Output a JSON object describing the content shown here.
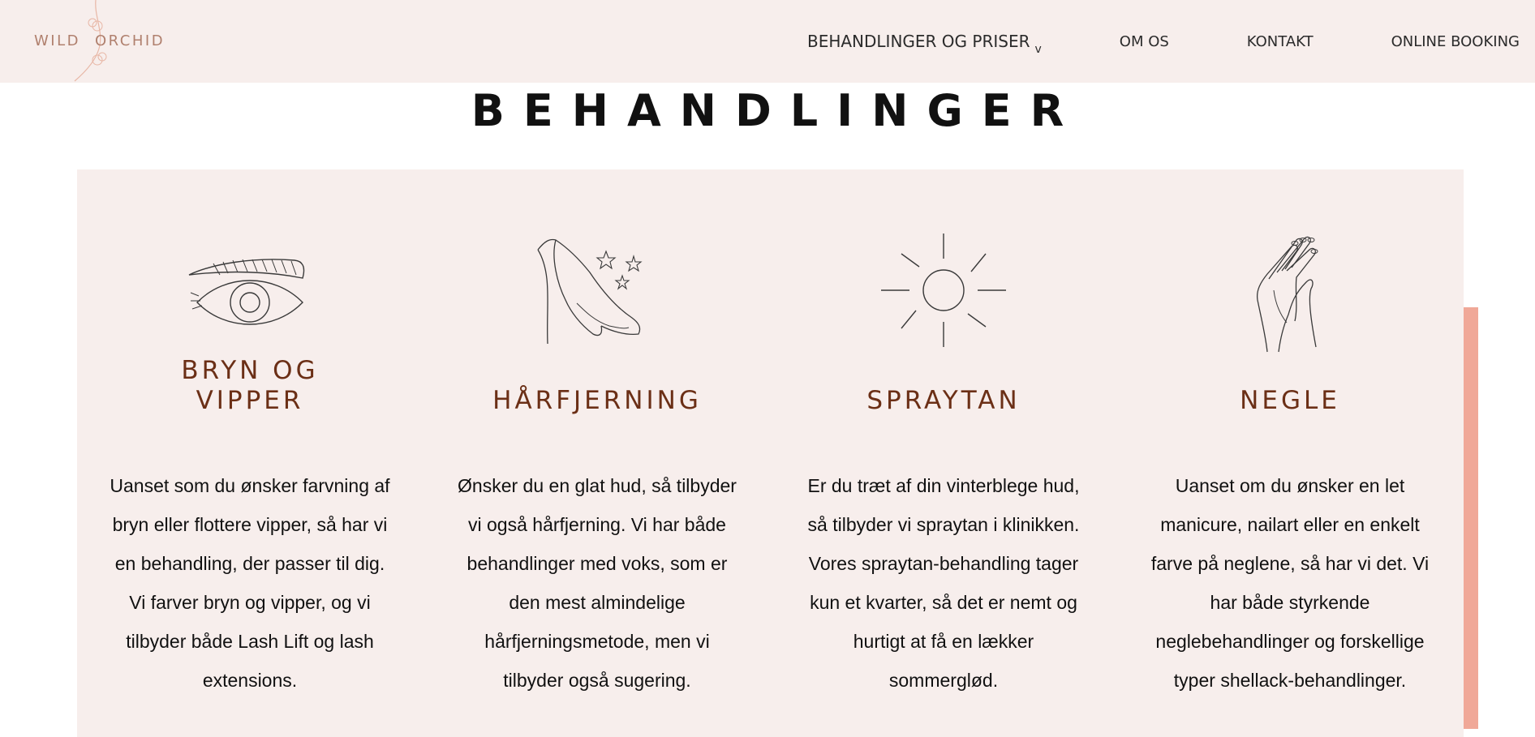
{
  "logo": {
    "word1": "WILD",
    "word2": "ORCHID"
  },
  "nav": {
    "items": [
      {
        "label": "BEHANDLINGER OG PRISER",
        "caret": "v"
      },
      {
        "label": "OM OS"
      },
      {
        "label": "KONTAKT"
      },
      {
        "label": "ONLINE BOOKING"
      }
    ]
  },
  "page_title": "BEHANDLINGER",
  "colors": {
    "header_bg": "#f7eeec",
    "panel_bg": "#f7eeec",
    "title_color": "#6b2f16",
    "accent": "#f0a898"
  },
  "treatments": [
    {
      "icon": "eye-brow-icon",
      "title_lines": [
        "BRYN OG",
        "VIPPER"
      ],
      "text": "Uanset som du ønsker farvning af bryn eller flottere vipper, så har vi en behandling, der passer til dig. Vi farver bryn og vipper, og vi tilbyder både Lash Lift og lash extensions."
    },
    {
      "icon": "leg-icon",
      "title_lines": [
        "HÅRFJERNING"
      ],
      "text": "Ønsker du en glat hud, så tilbyder vi også hårfjerning. Vi har både behandlinger med voks, som er den mest almindelige hårfjerningsmetode, men vi tilbyder også sugering."
    },
    {
      "icon": "sun-icon",
      "title_lines": [
        "SPRAYTAN"
      ],
      "text": "Er du træt af din vinterblege hud, så tilbyder vi spraytan i klinikken. Vores spraytan-behandling tager kun et kvarter, så det er nemt og hurtigt at få en lækker sommerglød."
    },
    {
      "icon": "hands-icon",
      "title_lines": [
        "NEGLE"
      ],
      "text": "Uanset om du ønsker en let manicure, nailart eller en enkelt farve på neglene, så har vi det. Vi har både styrkende neglebehandlinger og forskellige typer shellack-behandlinger."
    }
  ]
}
